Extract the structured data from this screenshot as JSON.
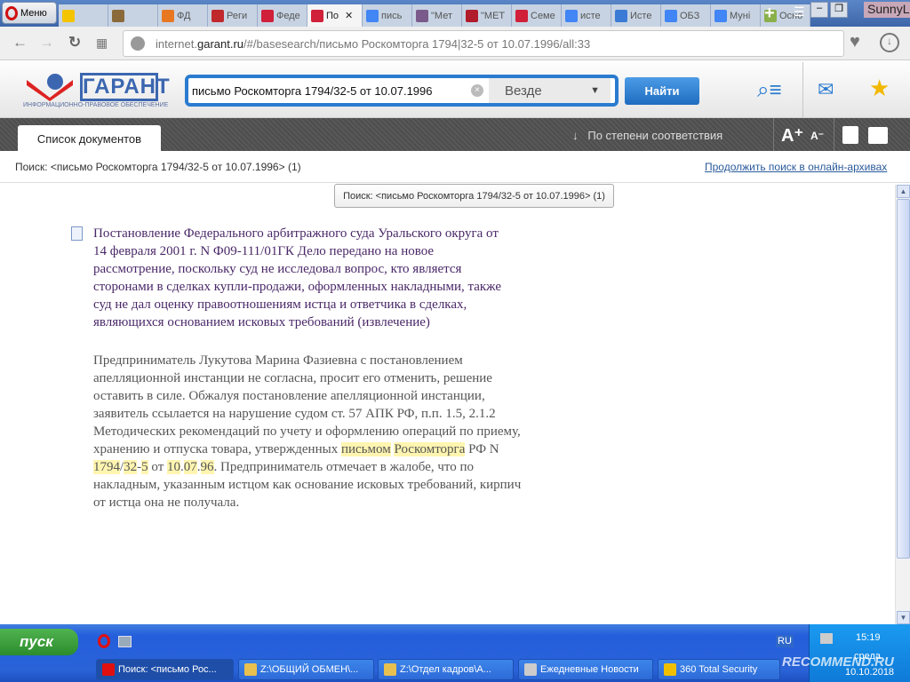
{
  "browser": {
    "menu_label": "Меню",
    "tabs": [
      {
        "label": "",
        "icon": "mail-icon",
        "color": "#f5c400"
      },
      {
        "label": "",
        "icon": "emblem-icon",
        "color": "#8a6a3a"
      },
      {
        "label": "ФД",
        "icon": "fd-icon",
        "color": "#e87722"
      },
      {
        "label": "Реги",
        "icon": "fire-extinguisher-icon",
        "color": "#c0282c"
      },
      {
        "label": "Феде",
        "icon": "garant-icon",
        "color": "#d0203a"
      },
      {
        "label": "По",
        "icon": "garant-icon",
        "color": "#d0203a",
        "active": true
      },
      {
        "label": "пись",
        "icon": "google-icon",
        "color": "#4285f4"
      },
      {
        "label": "\"Мет",
        "icon": "avatar-icon",
        "color": "#7a5a8a"
      },
      {
        "label": "\"МЕТ",
        "icon": "p-icon",
        "color": "#b01c2c"
      },
      {
        "label": "Семе",
        "icon": "garant-icon",
        "color": "#d0203a"
      },
      {
        "label": "исте",
        "icon": "google-icon",
        "color": "#4285f4"
      },
      {
        "label": "Исте",
        "icon": "v-icon",
        "color": "#3a7bd5"
      },
      {
        "label": "ОБЗ",
        "icon": "google-icon",
        "color": "#4285f4"
      },
      {
        "label": "Муні",
        "icon": "google-icon",
        "color": "#4285f4"
      },
      {
        "label": "Осно",
        "icon": "tree-icon",
        "color": "#8ab04a"
      }
    ],
    "tab_close": "✕",
    "user": "SunnyL",
    "url_prefix": "internet.",
    "url_domain": "garant.ru",
    "url_rest": "/#/basesearch/письмо Роскомторга 1794|32-5 от 10.07.1996/all:33"
  },
  "garant": {
    "logo_text": "ГАРАНТ",
    "logo_tagline": "ИНФОРМАЦИОННО-ПРАВОВОЕ ОБЕСПЕЧЕНИЕ",
    "search_value": "письмо Роскомторга 1794/32-5 от 10.07.1996",
    "scope": "Везде",
    "find_button": "Найти",
    "doc_tab": "Список документов",
    "sort_label": "По степени соответствия",
    "font_plus": "A⁺",
    "font_minus": "A⁻",
    "search_info": "Поиск: <письмо Роскомторга 1794/32-5 от 10.07.1996> (1)",
    "archive_link": "Продолжить поиск в онлайн-архивах",
    "tooltip": "Поиск: <письмо Роскомторга 1794/32-5 от 10.07.1996> (1)",
    "accent": "#2a7bd0"
  },
  "result": {
    "title": "Постановление Федерального арбитражного суда Уральского округа от 14 февраля 2001 г. N Ф09-111/01ГК Дело передано на новое рассмотрение, поскольку суд не исследовал вопрос, кто является сторонами в сделках купли-продажи, оформленных накладными, также суд не дал оценку правоотношениям истца и ответчика в сделках, являющихся основанием исковых требований (извлечение)",
    "body_1": "Предприниматель Лукутова Марина Фазиевна с постановлением апелляционной инстанции не согласна, просит его отменить, решение оставить в силе. Обжалуя постановление апелляционной инстанции, заявитель ссылается на нарушение судом ст. 57 АПК РФ, п.п. 1.5, 2.1.2 Методических рекомендаций по учету и оформлению операций по приему, хранению и отпуска товара, утвержденных ",
    "hl_1": "письмом",
    "sp_1": " ",
    "hl_2": "Роскомторга",
    "body_2": " РФ N ",
    "hl_3": "1794",
    "body_3": "/",
    "hl_4": "32",
    "body_4": "-",
    "hl_5": "5",
    "body_5": " от ",
    "hl_6": "10",
    "body_6": ".",
    "hl_7": "07",
    "body_7": ".",
    "hl_8": "96",
    "body_8": ". Предприниматель отмечает в жалобе, что по накладным, указанным истцом как основание исковых требований, кирпич от истца она не получала.",
    "highlight_color": "#fff5b0"
  },
  "taskbar": {
    "start": "пуск",
    "lang": "RU",
    "time": "15:19",
    "day": "среда",
    "date": "10.10.2018",
    "tasks": [
      {
        "label": "Поиск: <письмо Рос...",
        "icon": "opera-icon"
      },
      {
        "label": "Z:\\ОБЩИЙ ОБМЕН\\...",
        "icon": "folder-icon"
      },
      {
        "label": "Z:\\Отдел кадров\\А...",
        "icon": "folder-icon"
      },
      {
        "label": "Ежедневные Новости",
        "icon": "news-icon"
      },
      {
        "label": "360 Total Security",
        "icon": "360-security-icon"
      }
    ]
  },
  "watermark": "RECOMMEND.RU"
}
